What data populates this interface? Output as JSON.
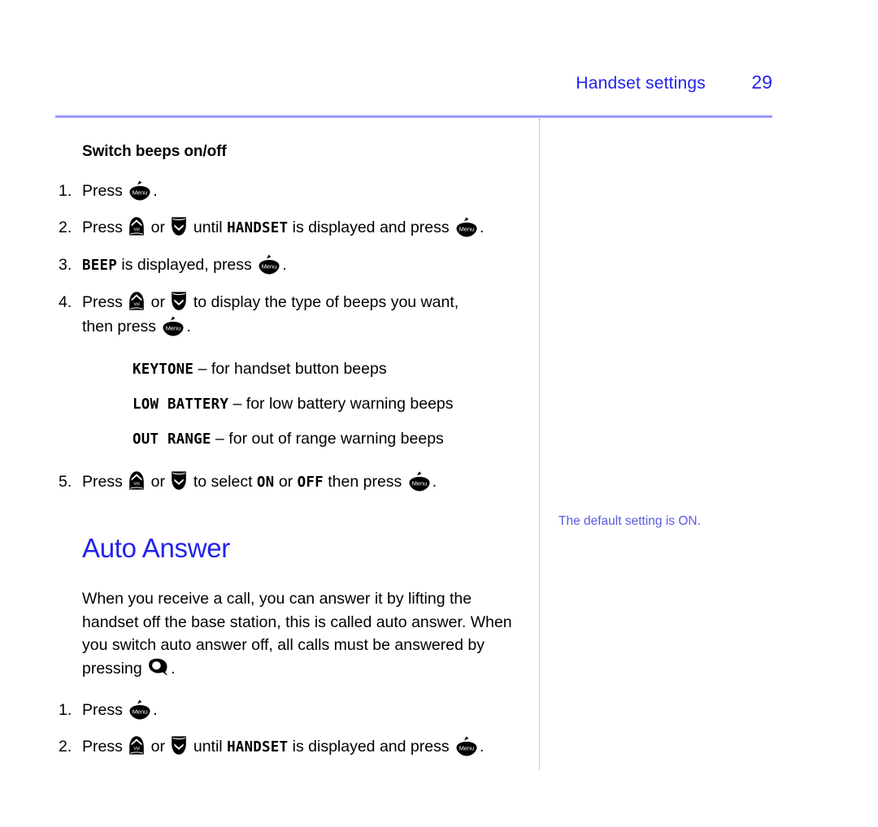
{
  "header": {
    "title": "Handset settings",
    "page_number": "29"
  },
  "colors": {
    "heading_blue": "#2222ee",
    "rule_blue": "#9a9aff",
    "divider_blue": "#8f8fe8",
    "sidenote_blue": "#5a5ae0",
    "text_black": "#000000"
  },
  "sections": {
    "switch_beeps": {
      "heading": "Switch beeps on/off",
      "steps": [
        {
          "number": "1.",
          "parts": [
            {
              "type": "text",
              "value": "Press "
            },
            {
              "type": "icon",
              "value": "menu-button-icon"
            },
            {
              "type": "text",
              "value": "."
            }
          ]
        },
        {
          "number": "2.",
          "parts": [
            {
              "type": "text",
              "value": "Press "
            },
            {
              "type": "icon",
              "value": "volume-up-button-icon"
            },
            {
              "type": "text",
              "value": " or "
            },
            {
              "type": "icon",
              "value": "volume-down-button-icon"
            },
            {
              "type": "text",
              "value": " until "
            },
            {
              "type": "lcd",
              "value": "HANDSET"
            },
            {
              "type": "text",
              "value": " is displayed and press "
            },
            {
              "type": "icon",
              "value": "menu-button-icon"
            },
            {
              "type": "text",
              "value": "."
            }
          ]
        },
        {
          "number": "3.",
          "parts": [
            {
              "type": "lcd",
              "value": "BEEP"
            },
            {
              "type": "text",
              "value": " is displayed, press "
            },
            {
              "type": "icon",
              "value": "menu-button-icon"
            },
            {
              "type": "text",
              "value": "."
            }
          ]
        },
        {
          "number": "4.",
          "parts": [
            {
              "type": "text",
              "value": "Press "
            },
            {
              "type": "icon",
              "value": "volume-up-button-icon"
            },
            {
              "type": "text",
              "value": " or "
            },
            {
              "type": "icon",
              "value": "volume-down-button-icon"
            },
            {
              "type": "text",
              "value": " to display the type of beeps you want, then press "
            },
            {
              "type": "icon",
              "value": "menu-button-icon"
            },
            {
              "type": "text",
              "value": "."
            }
          ]
        },
        {
          "number": "5.",
          "parts": [
            {
              "type": "text",
              "value": "Press "
            },
            {
              "type": "icon",
              "value": "volume-up-button-icon"
            },
            {
              "type": "text",
              "value": " or "
            },
            {
              "type": "icon",
              "value": "volume-down-button-icon"
            },
            {
              "type": "text",
              "value": " to select "
            },
            {
              "type": "lcd",
              "value": "ON"
            },
            {
              "type": "text",
              "value": " or "
            },
            {
              "type": "lcd",
              "value": "OFF"
            },
            {
              "type": "text",
              "value": " then press "
            },
            {
              "type": "icon",
              "value": "menu-button-icon"
            },
            {
              "type": "text",
              "value": "."
            }
          ]
        }
      ],
      "beep_types": [
        {
          "lcd": "KEYTONE",
          "description": " – for handset button beeps"
        },
        {
          "lcd": "LOW BATTERY",
          "description": " – for low battery warning beeps"
        },
        {
          "lcd": "OUT RANGE",
          "description": " – for out of range warning beeps"
        }
      ]
    },
    "auto_answer": {
      "heading": "Auto Answer",
      "paragraph_before_icon": "When you receive a call, you can answer it by lifting the handset off the base station, this is called auto answer. When you switch auto answer off, all calls must be answered by pressing ",
      "paragraph_after_icon": ".",
      "steps": [
        {
          "number": "1.",
          "parts": [
            {
              "type": "text",
              "value": "Press "
            },
            {
              "type": "icon",
              "value": "menu-button-icon"
            },
            {
              "type": "text",
              "value": "."
            }
          ]
        },
        {
          "number": "2.",
          "parts": [
            {
              "type": "text",
              "value": "Press "
            },
            {
              "type": "icon",
              "value": "volume-up-button-icon"
            },
            {
              "type": "text",
              "value": " or "
            },
            {
              "type": "icon",
              "value": "volume-down-button-icon"
            },
            {
              "type": "text",
              "value": " until "
            },
            {
              "type": "lcd",
              "value": "HANDSET"
            },
            {
              "type": "text",
              "value": " is displayed and press "
            },
            {
              "type": "icon",
              "value": "menu-button-icon"
            },
            {
              "type": "text",
              "value": "."
            }
          ]
        }
      ]
    }
  },
  "sidenote": {
    "text": "The default setting is ON."
  },
  "icon_labels": {
    "menu": "Menu",
    "volume": "Vol"
  },
  "step_numbers": {
    "n1": "1.",
    "n2": "2.",
    "n3": "3.",
    "n4": "4.",
    "n5": "5."
  },
  "inline": {
    "press": "Press ",
    "or": " or ",
    "until": " until ",
    "is_displayed_and_press": " is displayed and press ",
    "is_displayed_press": " is displayed, press ",
    "to_display_beeps": " to display the type of beeps you want,",
    "then_press": "then press ",
    "to_select": " to select ",
    "then_press_2": " then press ",
    "period": ".",
    "handset": "HANDSET",
    "beep": "BEEP",
    "on": "ON",
    "off": "OFF"
  }
}
